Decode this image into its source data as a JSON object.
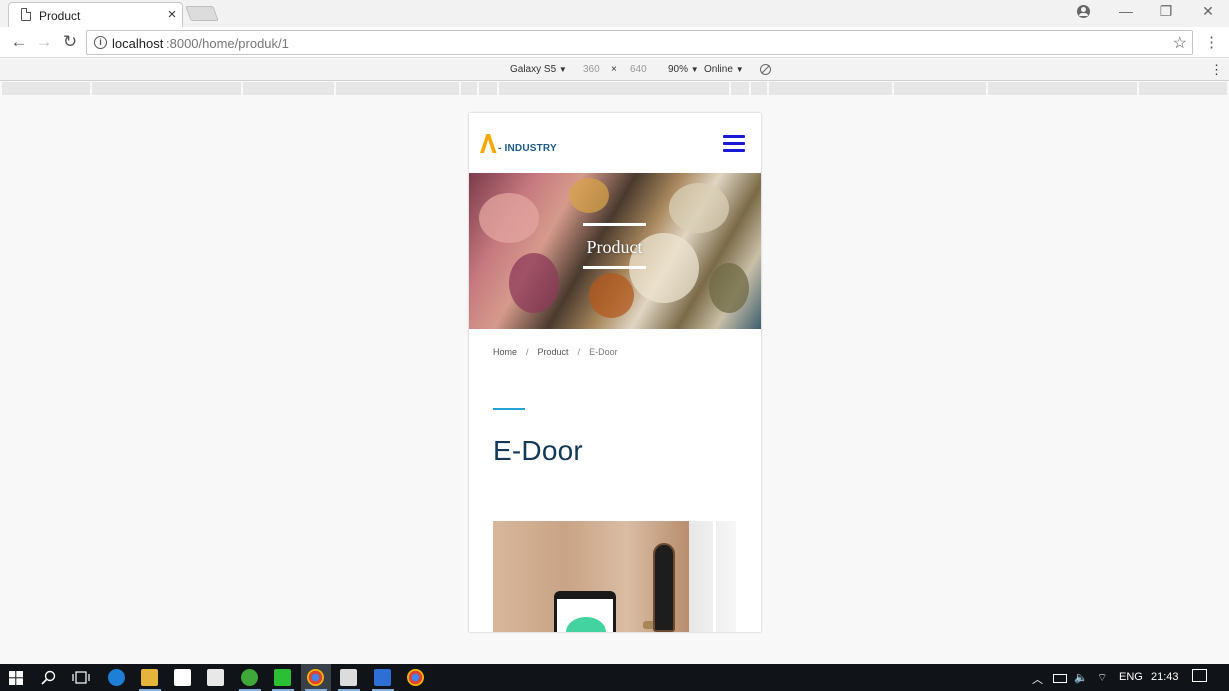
{
  "browser": {
    "tab": {
      "title": "Product",
      "close_label": "×"
    },
    "window_controls": {
      "minimize": "—",
      "restore": "❐",
      "close": "✕"
    },
    "nav": {
      "back": "←",
      "forward": "→",
      "reload": "↻"
    },
    "url": {
      "host": "localhost",
      "path": ":8000/home/produk/1"
    },
    "menu_dots": "⋮",
    "star": "☆"
  },
  "device_toolbar": {
    "device": "Galaxy S5",
    "width": "360",
    "times": "×",
    "height": "640",
    "zoom": "90%",
    "network": "Online",
    "dropdown_arrow": "▼",
    "menu_dots": "⋮"
  },
  "site": {
    "logo_text": "- INDUSTRY",
    "colors": {
      "logo_accent": "#f6a800",
      "logo_text": "#1b5a8a",
      "menu": "#1a1ad4",
      "heading": "#123a56",
      "title_accent": "#2aa2d6"
    },
    "hero_title": "Product",
    "breadcrumb": {
      "home": "Home",
      "separator": "/",
      "product": "Product",
      "current": "E-Door"
    },
    "page_heading": "E-Door"
  },
  "taskbar": {
    "lang": "ENG",
    "time": "21:43"
  }
}
